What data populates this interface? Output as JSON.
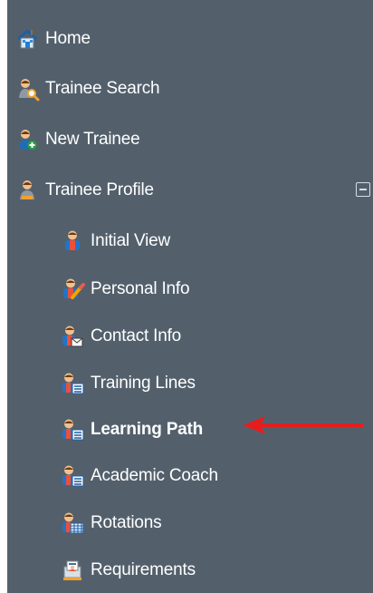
{
  "sidebar": {
    "items": [
      {
        "label": "Home",
        "icon": "home-icon"
      },
      {
        "label": "Trainee Search",
        "icon": "trainee-search-icon"
      },
      {
        "label": "New Trainee",
        "icon": "new-trainee-icon"
      },
      {
        "label": "Trainee Profile",
        "icon": "trainee-profile-icon",
        "expanded": true
      },
      {
        "label": "Initial View",
        "icon": "initial-view-icon"
      },
      {
        "label": "Personal Info",
        "icon": "personal-info-icon"
      },
      {
        "label": "Contact Info",
        "icon": "contact-info-icon"
      },
      {
        "label": "Training Lines",
        "icon": "training-lines-icon"
      },
      {
        "label": "Learning Path",
        "icon": "learning-path-icon",
        "current": true
      },
      {
        "label": "Academic Coach",
        "icon": "academic-coach-icon"
      },
      {
        "label": "Rotations",
        "icon": "rotations-icon"
      },
      {
        "label": "Requirements",
        "icon": "requirements-icon"
      }
    ]
  },
  "colors": {
    "sidebar_bg": "#53606c",
    "text": "#ffffff",
    "arrow": "#e41e1e"
  }
}
